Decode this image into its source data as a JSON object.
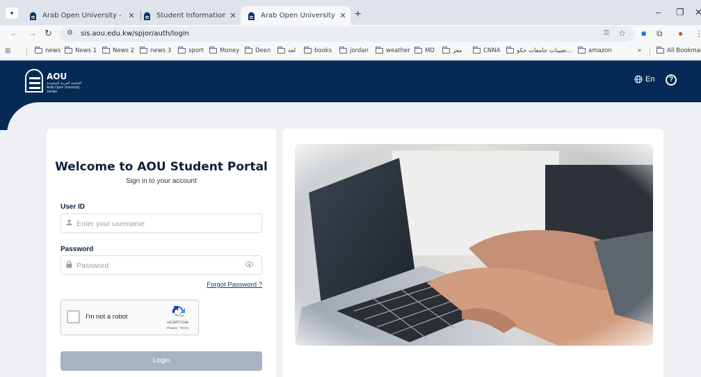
{
  "browser": {
    "tabs": [
      {
        "title": "Arab Open University - Jordan",
        "active": false
      },
      {
        "title": "Student Information System (S",
        "active": false
      },
      {
        "title": "Arab Open University",
        "active": true
      }
    ],
    "url": "sis.aou.edu.kw/spjor/auth/login",
    "bookmarks": [
      "news",
      "News 1",
      "News 2",
      "news 3",
      "sport",
      "Money",
      "Deen",
      "لغة",
      "books",
      "jordan",
      "weather",
      "MD",
      "معز",
      "CNNA",
      "تعيينات جامعات حكو...",
      "amazon"
    ],
    "overflow_label": "»",
    "all_bookmarks_label": "All Bookmarks"
  },
  "header": {
    "logo_title": "AOU",
    "logo_arabic": "الجامعة العربية المفتوحة",
    "logo_english": "Arab Open University",
    "logo_country": "Jordan",
    "language_label": "En",
    "help_glyph": "?",
    "colors": {
      "banner": "#052a55"
    }
  },
  "login": {
    "welcome": "Welcome to AOU Student Portal",
    "subtitle": "Sign in to your account",
    "user_id_label": "User ID",
    "username_placeholder": "Enter your username",
    "password_label": "Password",
    "password_placeholder": "Password",
    "forgot_password": "Forgot Password ?",
    "recaptcha_label": "I'm not a robot",
    "recaptcha_brand": "reCAPTCHA",
    "recaptcha_links": "Privacy - Terms",
    "login_button": "Login"
  },
  "icons": {
    "tab_menu": "chevron-down-icon",
    "favicon": "aou-favicon-icon",
    "user": "user-icon",
    "lock": "lock-icon",
    "eye": "eye-icon",
    "globe": "globe-icon",
    "help": "help-circle-icon"
  }
}
